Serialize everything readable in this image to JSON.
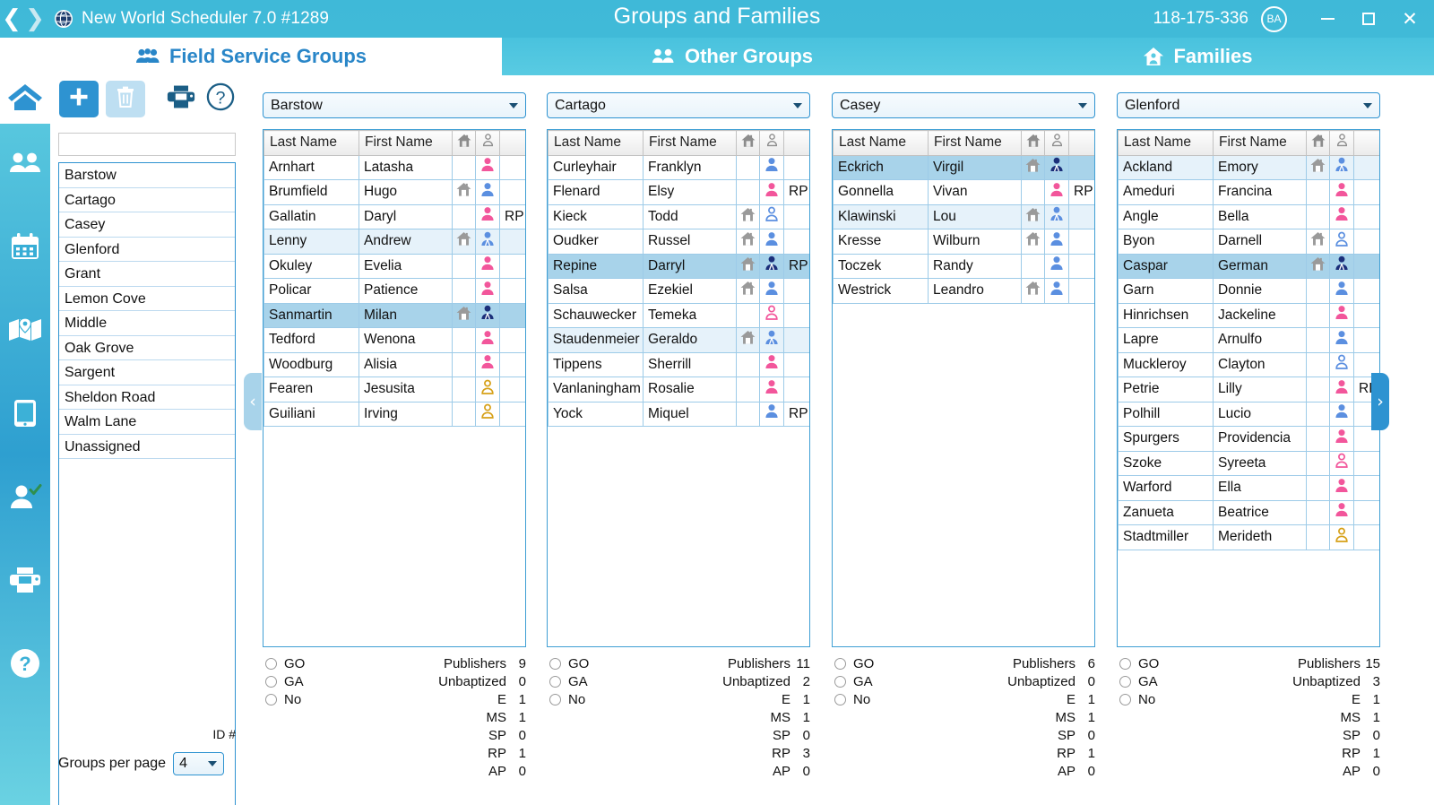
{
  "titlebar": {
    "back_icon": "chevron-left-icon",
    "forward_icon": "chevron-right-icon",
    "globe_icon": "globe-icon",
    "app_title": "New World Scheduler  7.0 #1289",
    "page_title": "Groups and Families",
    "license": "118-175-336",
    "user_initials": "BA",
    "minimize_label": "Minimize",
    "maximize_label": "Maximize",
    "close_label": "Close"
  },
  "tabs": [
    {
      "label": "Field Service Groups",
      "icon": "people-group-icon",
      "active": true
    },
    {
      "label": "Other Groups",
      "icon": "people-group-icon",
      "active": false
    },
    {
      "label": "Families",
      "icon": "house-family-icon",
      "active": false
    }
  ],
  "rail": [
    {
      "icon": "home-icon",
      "name": "home"
    },
    {
      "icon": "people-icon",
      "name": "publishers"
    },
    {
      "icon": "calendar-icon",
      "name": "calendar"
    },
    {
      "icon": "map-icon",
      "name": "territories"
    },
    {
      "icon": "tablet-icon",
      "name": "devices"
    },
    {
      "icon": "person-check-icon",
      "name": "assignments"
    },
    {
      "icon": "printer-icon",
      "name": "reports"
    },
    {
      "icon": "help-circle-icon",
      "name": "help"
    }
  ],
  "toolbar": {
    "add_icon": "plus-icon",
    "delete_icon": "trash-icon",
    "print_icon": "printer-icon",
    "help_icon": "question-circle-icon"
  },
  "sidebar": {
    "filter_value": "",
    "filter_placeholder": "",
    "items": [
      "Barstow",
      "Cartago",
      "Casey",
      "Glenford",
      "Grant",
      "Lemon Cove",
      "Middle",
      "Oak Grove",
      "Sargent",
      "Sheldon Road",
      "Walm Lane",
      "Unassigned"
    ],
    "id_label": "ID #",
    "per_page_label": "Groups per page",
    "per_page_value": "4"
  },
  "table_headers": {
    "last": "Last Name",
    "first": "First Name",
    "home": "house-icon",
    "priv": "person-icon",
    "rp": ""
  },
  "stat_labels": {
    "go": "GO",
    "ga": "GA",
    "no": "No",
    "publishers": "Publishers",
    "unbaptized": "Unbaptized",
    "e": "E",
    "ms": "MS",
    "sp": "SP",
    "rp": "RP",
    "ap": "AP"
  },
  "paddles": {
    "left": "‹",
    "right": "›"
  },
  "colors": {
    "accent": "#2e93d1",
    "header_gradient_top": "#3fb9d8",
    "tab_active_text": "#2986c8",
    "select_dark": "#a8d3ea",
    "select_light": "#e6f2fa",
    "female_pink": "#f2569b",
    "male_blue": "#5b8fe0",
    "elder_navy": "#1b2f7a",
    "unbaptized_gold": "#d6a017"
  },
  "groups": [
    {
      "name": "Barstow",
      "rows": [
        {
          "last": "Arnhart",
          "first": "Latasha",
          "home": false,
          "priv": "female",
          "rp": "",
          "sel": ""
        },
        {
          "last": "Brumfield",
          "first": "Hugo",
          "home": true,
          "priv": "male",
          "rp": "",
          "sel": ""
        },
        {
          "last": "Gallatin",
          "first": "Daryl",
          "home": false,
          "priv": "female",
          "rp": "RP",
          "sel": ""
        },
        {
          "last": "Lenny",
          "first": "Andrew",
          "home": true,
          "priv": "ms",
          "rp": "",
          "sel": "light"
        },
        {
          "last": "Okuley",
          "first": "Evelia",
          "home": false,
          "priv": "female",
          "rp": "",
          "sel": ""
        },
        {
          "last": "Policar",
          "first": "Patience",
          "home": false,
          "priv": "female",
          "rp": "",
          "sel": ""
        },
        {
          "last": "Sanmartin",
          "first": "Milan",
          "home": true,
          "priv": "elder",
          "rp": "",
          "sel": "dark"
        },
        {
          "last": "Tedford",
          "first": "Wenona",
          "home": false,
          "priv": "female",
          "rp": "",
          "sel": ""
        },
        {
          "last": "Woodburg",
          "first": "Alisia",
          "home": false,
          "priv": "female",
          "rp": "",
          "sel": ""
        },
        {
          "last": "Fearen",
          "first": "Jesusita",
          "home": false,
          "priv": "unbap-gold",
          "rp": "",
          "sel": ""
        },
        {
          "last": "Guiliani",
          "first": "Irving",
          "home": false,
          "priv": "unbap-gold",
          "rp": "",
          "sel": ""
        }
      ],
      "stats": {
        "publishers": "9",
        "unbaptized": "0",
        "e": "1",
        "ms": "1",
        "sp": "0",
        "rp": "1",
        "ap": "0"
      }
    },
    {
      "name": "Cartago",
      "rows": [
        {
          "last": "Curleyhair",
          "first": "Franklyn",
          "home": false,
          "priv": "male",
          "rp": "",
          "sel": ""
        },
        {
          "last": "Flenard",
          "first": "Elsy",
          "home": false,
          "priv": "female",
          "rp": "RP",
          "sel": ""
        },
        {
          "last": "Kieck",
          "first": "Todd",
          "home": true,
          "priv": "unbap-blue",
          "rp": "",
          "sel": ""
        },
        {
          "last": "Oudker",
          "first": "Russel",
          "home": true,
          "priv": "male",
          "rp": "",
          "sel": ""
        },
        {
          "last": "Repine",
          "first": "Darryl",
          "home": true,
          "priv": "elder",
          "rp": "RP",
          "sel": "dark"
        },
        {
          "last": "Salsa",
          "first": "Ezekiel",
          "home": true,
          "priv": "male",
          "rp": "",
          "sel": ""
        },
        {
          "last": "Schauwecker",
          "first": "Temeka",
          "home": false,
          "priv": "unbap-pink",
          "rp": "",
          "sel": ""
        },
        {
          "last": "Staudenmeier",
          "first": "Geraldo",
          "home": true,
          "priv": "ms",
          "rp": "",
          "sel": "light"
        },
        {
          "last": "Tippens",
          "first": "Sherrill",
          "home": false,
          "priv": "female",
          "rp": "",
          "sel": ""
        },
        {
          "last": "Vanlaningham",
          "first": "Rosalie",
          "home": false,
          "priv": "female",
          "rp": "",
          "sel": ""
        },
        {
          "last": "Yock",
          "first": "Miquel",
          "home": false,
          "priv": "male",
          "rp": "RP",
          "sel": ""
        }
      ],
      "stats": {
        "publishers": "11",
        "unbaptized": "2",
        "e": "1",
        "ms": "1",
        "sp": "0",
        "rp": "3",
        "ap": "0"
      }
    },
    {
      "name": "Casey",
      "rows": [
        {
          "last": "Eckrich",
          "first": "Virgil",
          "home": true,
          "priv": "elder",
          "rp": "",
          "sel": "dark"
        },
        {
          "last": "Gonnella",
          "first": "Vivan",
          "home": false,
          "priv": "female",
          "rp": "RP",
          "sel": ""
        },
        {
          "last": "Klawinski",
          "first": "Lou",
          "home": true,
          "priv": "ms",
          "rp": "",
          "sel": "light"
        },
        {
          "last": "Kresse",
          "first": "Wilburn",
          "home": true,
          "priv": "male",
          "rp": "",
          "sel": ""
        },
        {
          "last": "Toczek",
          "first": "Randy",
          "home": false,
          "priv": "male",
          "rp": "",
          "sel": ""
        },
        {
          "last": "Westrick",
          "first": "Leandro",
          "home": true,
          "priv": "male",
          "rp": "",
          "sel": ""
        }
      ],
      "stats": {
        "publishers": "6",
        "unbaptized": "0",
        "e": "1",
        "ms": "1",
        "sp": "0",
        "rp": "1",
        "ap": "0"
      }
    },
    {
      "name": "Glenford",
      "rows": [
        {
          "last": "Ackland",
          "first": "Emory",
          "home": true,
          "priv": "ms",
          "rp": "",
          "sel": "light"
        },
        {
          "last": "Ameduri",
          "first": "Francina",
          "home": false,
          "priv": "female",
          "rp": "",
          "sel": ""
        },
        {
          "last": "Angle",
          "first": "Bella",
          "home": false,
          "priv": "female",
          "rp": "",
          "sel": ""
        },
        {
          "last": "Byon",
          "first": "Darnell",
          "home": true,
          "priv": "unbap-blue",
          "rp": "",
          "sel": ""
        },
        {
          "last": "Caspar",
          "first": "German",
          "home": true,
          "priv": "elder",
          "rp": "",
          "sel": "dark"
        },
        {
          "last": "Garn",
          "first": "Donnie",
          "home": false,
          "priv": "male",
          "rp": "",
          "sel": ""
        },
        {
          "last": "Hinrichsen",
          "first": "Jackeline",
          "home": false,
          "priv": "female",
          "rp": "",
          "sel": ""
        },
        {
          "last": "Lapre",
          "first": "Arnulfo",
          "home": false,
          "priv": "male",
          "rp": "",
          "sel": ""
        },
        {
          "last": "Muckleroy",
          "first": "Clayton",
          "home": false,
          "priv": "unbap-blue",
          "rp": "",
          "sel": ""
        },
        {
          "last": "Petrie",
          "first": "Lilly",
          "home": false,
          "priv": "female",
          "rp": "RP",
          "sel": ""
        },
        {
          "last": "Polhill",
          "first": "Lucio",
          "home": false,
          "priv": "male",
          "rp": "",
          "sel": ""
        },
        {
          "last": "Spurgers",
          "first": "Providencia",
          "home": false,
          "priv": "female",
          "rp": "",
          "sel": ""
        },
        {
          "last": "Szoke",
          "first": "Syreeta",
          "home": false,
          "priv": "unbap-pink",
          "rp": "",
          "sel": ""
        },
        {
          "last": "Warford",
          "first": "Ella",
          "home": false,
          "priv": "female",
          "rp": "",
          "sel": ""
        },
        {
          "last": "Zanueta",
          "first": "Beatrice",
          "home": false,
          "priv": "female",
          "rp": "",
          "sel": ""
        },
        {
          "last": "Stadtmiller",
          "first": "Merideth",
          "home": false,
          "priv": "unbap-gold",
          "rp": "",
          "sel": ""
        }
      ],
      "stats": {
        "publishers": "15",
        "unbaptized": "3",
        "e": "1",
        "ms": "1",
        "sp": "0",
        "rp": "1",
        "ap": "0"
      }
    }
  ]
}
